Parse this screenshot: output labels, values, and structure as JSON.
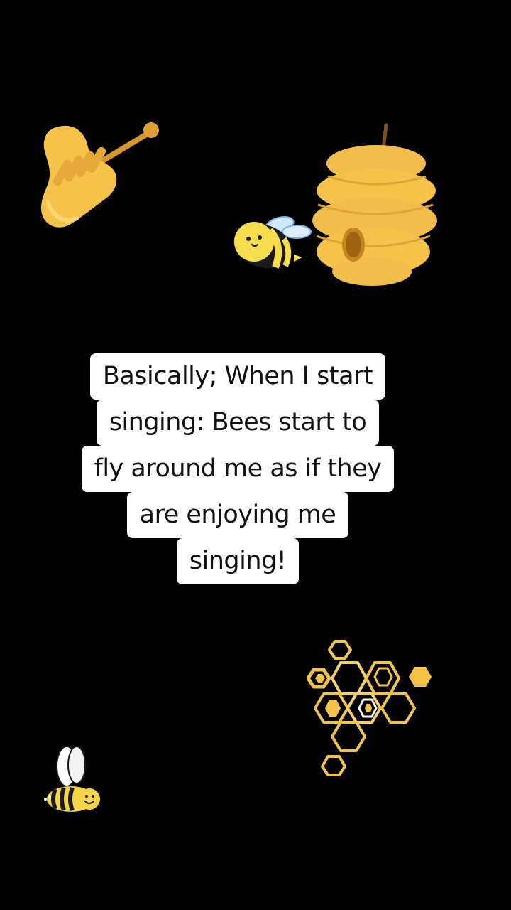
{
  "caption": {
    "lines": [
      "Basically; When I start",
      "singing: Bees start to",
      "fly around me as if they",
      "are enjoying me",
      "singing!"
    ]
  },
  "stickers": {
    "dipper": "honey-dipper-icon",
    "bee_flying": "bee-icon",
    "beehive": "beehive-icon",
    "honeycomb": "honeycomb-icon",
    "bee_small": "bee-icon"
  },
  "colors": {
    "background": "#000000",
    "caption_bg": "#ffffff",
    "caption_text": "#111111",
    "honey": "#f5c24a",
    "honey_dark": "#d9962b",
    "outline": "#3a2a10"
  }
}
